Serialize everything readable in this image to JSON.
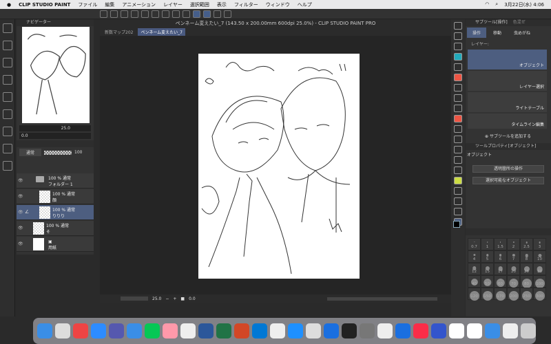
{
  "menubar": {
    "apple": "",
    "app": "CLIP STUDIO PAINT",
    "items": [
      "ファイル",
      "編集",
      "アニメーション",
      "レイヤー",
      "選択範囲",
      "表示",
      "フィルター",
      "ウィンドウ",
      "ヘルプ"
    ],
    "clock": "3月22日(水) 4:06"
  },
  "window": {
    "title": "ペンネーム変えたい_7 (143.50 x 200.00mm 600dpi 25.0%) - CLIP STUDIO PAINT PRO",
    "tabs": [
      "新数マップ202",
      "ペンネーム変えたい_7"
    ]
  },
  "navigator": {
    "title": "ナビゲーター",
    "zoom": "25.0",
    "angle": "0.0"
  },
  "layers": {
    "blend": "通常",
    "opacity": "100",
    "rows": [
      {
        "info": "100 % 通常",
        "name": "フォルダー 1",
        "type": "folder"
      },
      {
        "info": "100 % 通常",
        "name": "顔"
      },
      {
        "info": "100 % 通常",
        "name": "りりり",
        "selected": true
      },
      {
        "info": "100 % 通常",
        "name": "そ"
      },
      {
        "info": "",
        "name": "用紙",
        "type": "paper"
      }
    ]
  },
  "subtool": {
    "title": "サブツール[操作]",
    "tab2": "色混ぜ",
    "tools": [
      "操作",
      "移動",
      "虫めがね"
    ],
    "layer_label": "レイヤー:",
    "items": [
      "オブジェクト",
      "レイヤー選択",
      "ライトテーブル",
      "タイムライン編集"
    ],
    "add": "サブツールを追加する"
  },
  "toolprop": {
    "title": "ツールプロパティ[オブジェクト]",
    "name": "オブジェクト",
    "dropdowns": [
      "透明箇所の操作",
      "選択可能なオブジェクト"
    ]
  },
  "brush_sizes": [
    "0.7",
    "1",
    "1.5",
    "2",
    "2.5",
    "3",
    "4",
    "5",
    "6",
    "7",
    "8",
    "10",
    "12",
    "15",
    "17",
    "20",
    "25",
    "30",
    "40",
    "50",
    "60",
    "70",
    "80",
    "100",
    "120",
    "150",
    "170",
    "200",
    "250",
    "300"
  ],
  "statusbar": {
    "zoom": "25.0",
    "angle": "0.0"
  },
  "colors": {
    "accent": "#4d5e80",
    "main_color": "#000000",
    "sub_color": "#e84a4a"
  }
}
